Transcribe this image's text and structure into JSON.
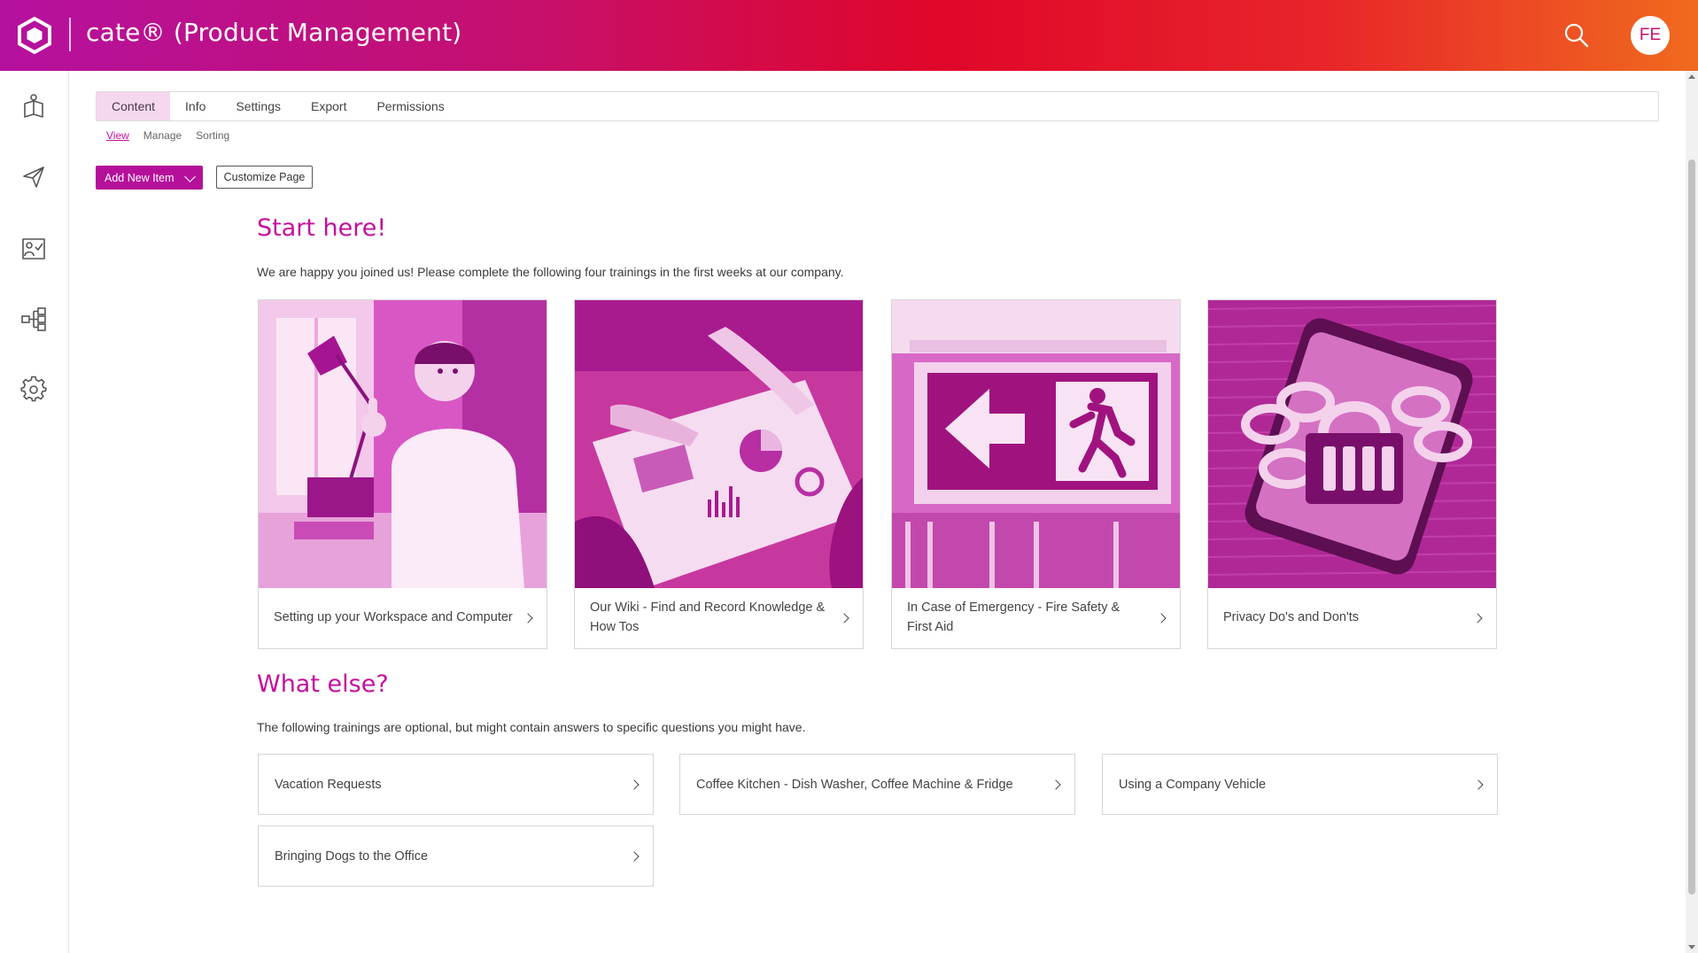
{
  "header": {
    "app_title": "cate® (Product Management)",
    "avatar_initials": "FE",
    "gradient_colors": [
      "#b5119f",
      "#e0062a",
      "#f06a1e"
    ]
  },
  "sidebar": {
    "items": [
      {
        "icon": "courses-icon"
      },
      {
        "icon": "send-icon"
      },
      {
        "icon": "assignments-icon"
      },
      {
        "icon": "structure-icon"
      },
      {
        "icon": "gear-icon"
      }
    ]
  },
  "tabs": {
    "items": [
      {
        "label": "Content",
        "active": true
      },
      {
        "label": "Info"
      },
      {
        "label": "Settings"
      },
      {
        "label": "Export"
      },
      {
        "label": "Permissions"
      }
    ],
    "sub_items": [
      {
        "label": "View",
        "active": true
      },
      {
        "label": "Manage"
      },
      {
        "label": "Sorting"
      }
    ]
  },
  "actions": {
    "add_new_item": "Add New Item",
    "customize_page": "Customize Page"
  },
  "start_section": {
    "title": "Start here!",
    "intro": "We are happy you joined us! Please complete the following four trainings in the first weeks at our company.",
    "cards": [
      {
        "label": "Setting up your Workspace and Computer",
        "image": "office-worker-thumbs-up"
      },
      {
        "label": "Our Wiki - Find and Record Knowledge & How Tos",
        "image": "team-reviewing-charts"
      },
      {
        "label": "In Case of Emergency - Fire Safety & First Aid",
        "image": "emergency-exit-sign"
      },
      {
        "label": "Privacy Do's and Don'ts",
        "image": "phone-chained-with-padlock"
      }
    ]
  },
  "optional_section": {
    "title": "What else?",
    "intro": "The following trainings are optional, but might contain answers to specific questions you might have.",
    "tiles": [
      {
        "label": "Vacation Requests"
      },
      {
        "label": "Coffee Kitchen - Dish Washer, Coffee Machine & Fridge"
      },
      {
        "label": "Using a Company Vehicle"
      },
      {
        "label": "Bringing Dogs to the Office"
      }
    ]
  },
  "colors": {
    "accent": "#c5109c",
    "button": "#b5109a",
    "active_tab_bg": "#f5d8ee"
  }
}
